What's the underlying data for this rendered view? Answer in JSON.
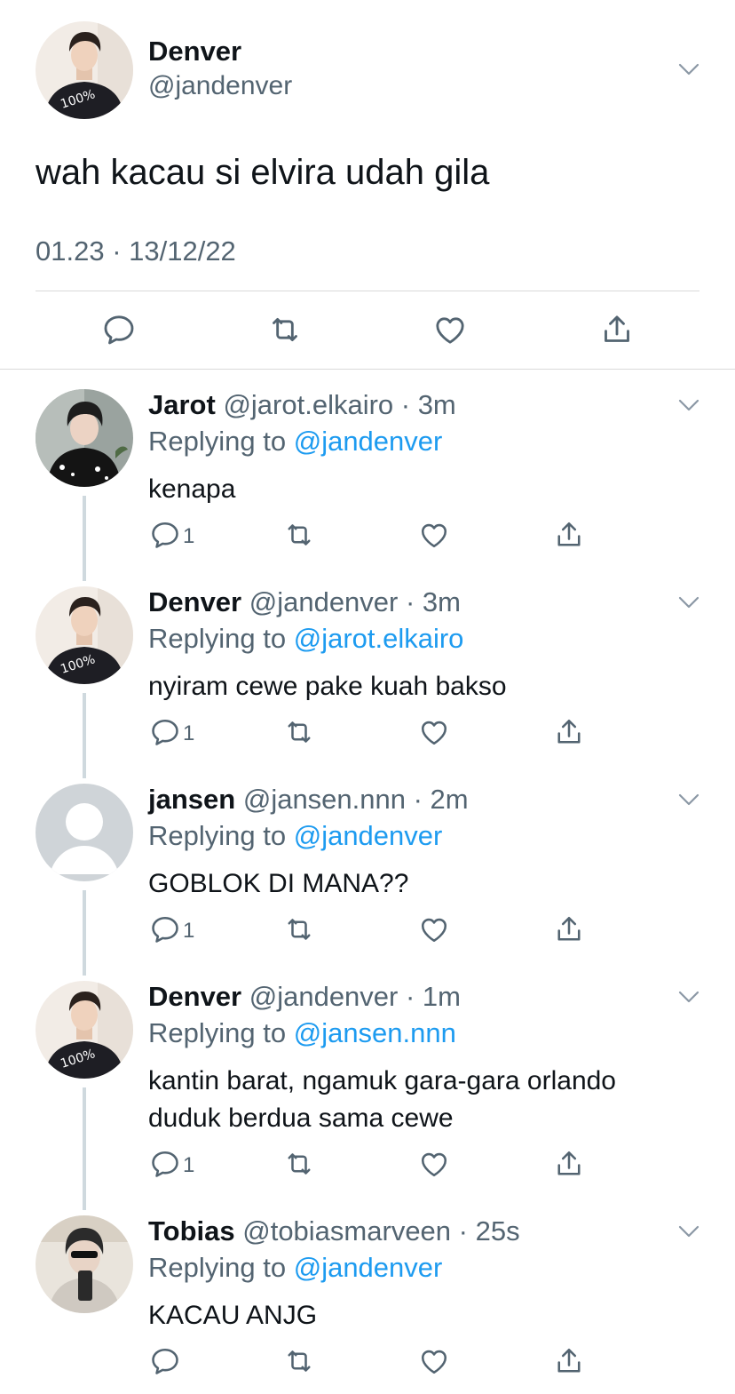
{
  "main": {
    "name": "Denver",
    "handle": "@jandenver",
    "text": "wah kacau si elvira udah gila",
    "time": "01.23 · 13/12/22"
  },
  "colors": {
    "link": "#1d9bf0",
    "muted": "#536471",
    "text": "#0f1419",
    "divider": "#d9d9d9",
    "thread": "#cfd9de"
  },
  "icons": [
    "chevron-down-icon",
    "reply-icon",
    "retweet-icon",
    "like-icon",
    "share-icon"
  ],
  "replies": [
    {
      "name": "Jarot",
      "meta": "@jarot.elkairo · 3m",
      "replying_label": "Replying to ",
      "replying_to": "@jandenver",
      "text": "kenapa",
      "reply_count": "1"
    },
    {
      "name": "Denver",
      "meta": "@jandenver · 3m",
      "replying_label": "Replying to ",
      "replying_to": "@jarot.elkairo",
      "text": "nyiram cewe pake kuah bakso",
      "reply_count": "1"
    },
    {
      "name": "jansen",
      "meta": "@jansen.nnn · 2m",
      "replying_label": "Replying to ",
      "replying_to": "@jandenver",
      "text": "GOBLOK DI MANA??",
      "reply_count": "1"
    },
    {
      "name": "Denver",
      "meta": "@jandenver · 1m",
      "replying_label": "Replying to ",
      "replying_to": "@jansen.nnn",
      "text_line1": "kantin barat, ngamuk gara-gara orlando",
      "text_line2": "duduk berdua sama cewe",
      "reply_count": "1"
    },
    {
      "name": "Tobias",
      "meta": "@tobiasmarveen · 25s",
      "replying_label": "Replying to ",
      "replying_to": "@jandenver",
      "text": "KACAU ANJG",
      "reply_count": ""
    }
  ]
}
